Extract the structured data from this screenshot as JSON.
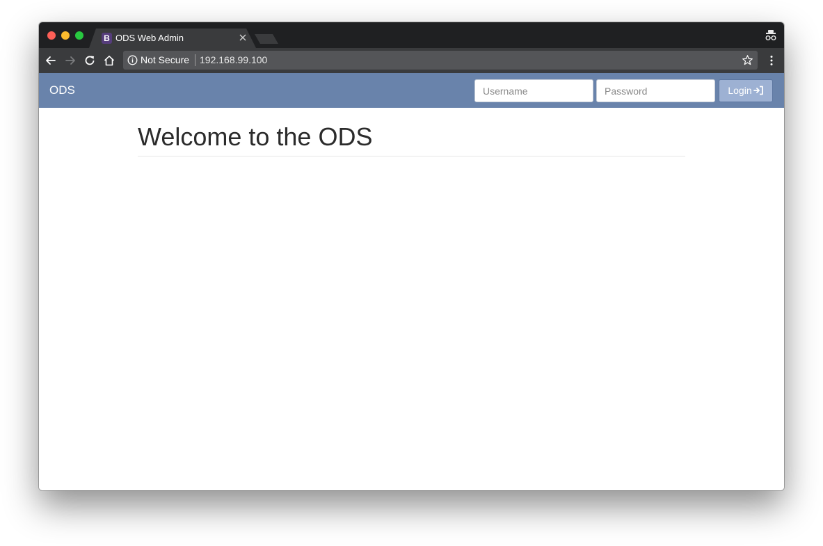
{
  "browser": {
    "tab": {
      "favicon_letter": "B",
      "title": "ODS Web Admin"
    },
    "omnibox": {
      "security_label": "Not Secure",
      "url": "192.168.99.100"
    }
  },
  "navbar": {
    "brand": "ODS",
    "username_placeholder": "Username",
    "password_placeholder": "Password",
    "login_label": "Login"
  },
  "main": {
    "heading": "Welcome to the ODS"
  },
  "colors": {
    "navbar_bg": "#6983ab",
    "login_bg": "#9db1d3",
    "favicon_bg": "#563d7c",
    "tabstrip_bg": "#1f2022",
    "toolbar_bg": "#3a3b3d"
  }
}
